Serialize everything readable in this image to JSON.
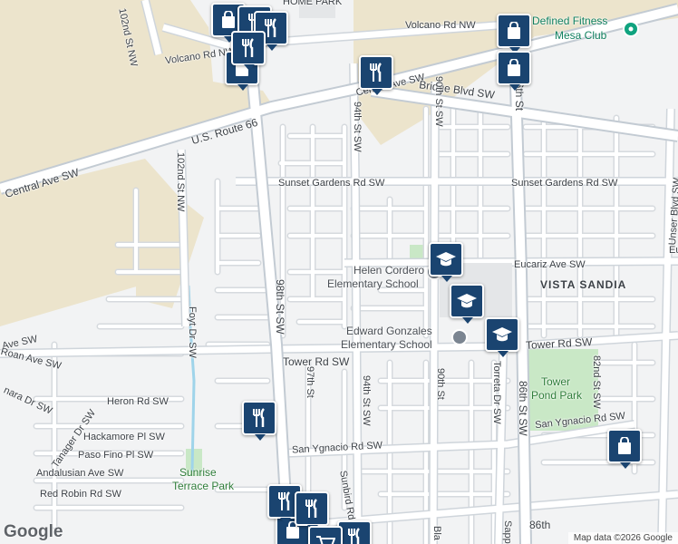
{
  "map": {
    "labels": {
      "home_park": "HOME PARK",
      "st_102nd_nw_top": "102nd St NW",
      "volcano_rd_nw_left": "Volcano Rd NW",
      "volcano_rd_nw_right": "Volcano Rd NW",
      "defined_fitness": "Defined Fitness",
      "mesa_club": "Mesa Club",
      "central_ave_sw_top": "Central Ave SW",
      "bridge_blvd_sw": "Bridge Blvd SW",
      "us_route_66": "U.S. Route 66",
      "central_ave_sw_left": "Central Ave SW",
      "st_102nd_nw": "102nd St NW",
      "st_94th_sw_top": "94th St SW",
      "st_90th_sw_top": "90th St SW",
      "st_86th_top": "86th St",
      "sunset_gardens_left": "Sunset Gardens Rd SW",
      "sunset_gardens_right": "Sunset Gardens Rd SW",
      "unser_blvd_sw": "Unser Blvd SW",
      "helen_cordero_1": "Helen Cordero",
      "helen_cordero_2": "Elementary School",
      "eucariz_ave_sw": "Eucariz Ave SW",
      "eucariz_right": "Eu",
      "vista_sandia": "VISTA SANDIA",
      "st_98th_sw": "98th St SW",
      "foyt_dr_sw": "Foyt Dr SW",
      "edward_gonzales_1": "Edward Gonzales",
      "edward_gonzales_2": "Elementary School",
      "ave_sw_left": "Ave SW",
      "roan_ave_sw": "Roan Ave SW",
      "tower_rd_sw_left": "Tower Rd SW",
      "tower_rd_sw_right": "Tower Rd SW",
      "nara_dr_sw": "nara Dr SW",
      "tanager_dr_sw": "Tanager Dr SW",
      "st_97th": "97th St",
      "st_94th_sw_mid": "94th St SW",
      "st_90th": "90th St",
      "torreta_dr_sw": "Torreta Dr SW",
      "st_86th_sw": "86th St SW",
      "tower_pond_park_1": "Tower",
      "tower_pond_park_2": "Pond Park",
      "st_82nd_sw": "82nd St SW",
      "heron_rd_sw": "Heron Rd SW",
      "hackamore_pl_sw": "Hackamore Pl SW",
      "paso_fino_pl_sw": "Paso Fino Pl SW",
      "san_ygnacio_left": "San Ygnacio Rd SW",
      "san_ygnacio_right": "San Ygnacio Rd SW",
      "andalusian_ave_sw": "Andalusian Ave SW",
      "sunrise_terrace_1": "Sunrise",
      "sunrise_terrace_2": "Terrace Park",
      "red_robin_rd_sw": "Red Robin Rd SW",
      "sunbird_rd_sw": "Sunbird Rd SW",
      "bla": "Bla",
      "sapp": "Sapp",
      "st_86th_bottom": "86th"
    },
    "markers": [
      {
        "name": "shopping-bag-icon",
        "type": "shopping"
      },
      {
        "name": "restaurant-icon",
        "type": "restaurant"
      },
      {
        "name": "school-icon",
        "type": "school"
      },
      {
        "name": "shopping-cart-icon",
        "type": "grocery"
      }
    ],
    "colors": {
      "background": "#f2f3f4",
      "road": "#ffffff",
      "road_casing": "#d6dade",
      "highway": "#c3cbd3",
      "arid_land": "#ece4cc",
      "park": "#c9e8c6",
      "marker": "#1a4470"
    }
  },
  "attribution": {
    "logo": "Google",
    "data_text": "Map data ©2026 Google"
  }
}
